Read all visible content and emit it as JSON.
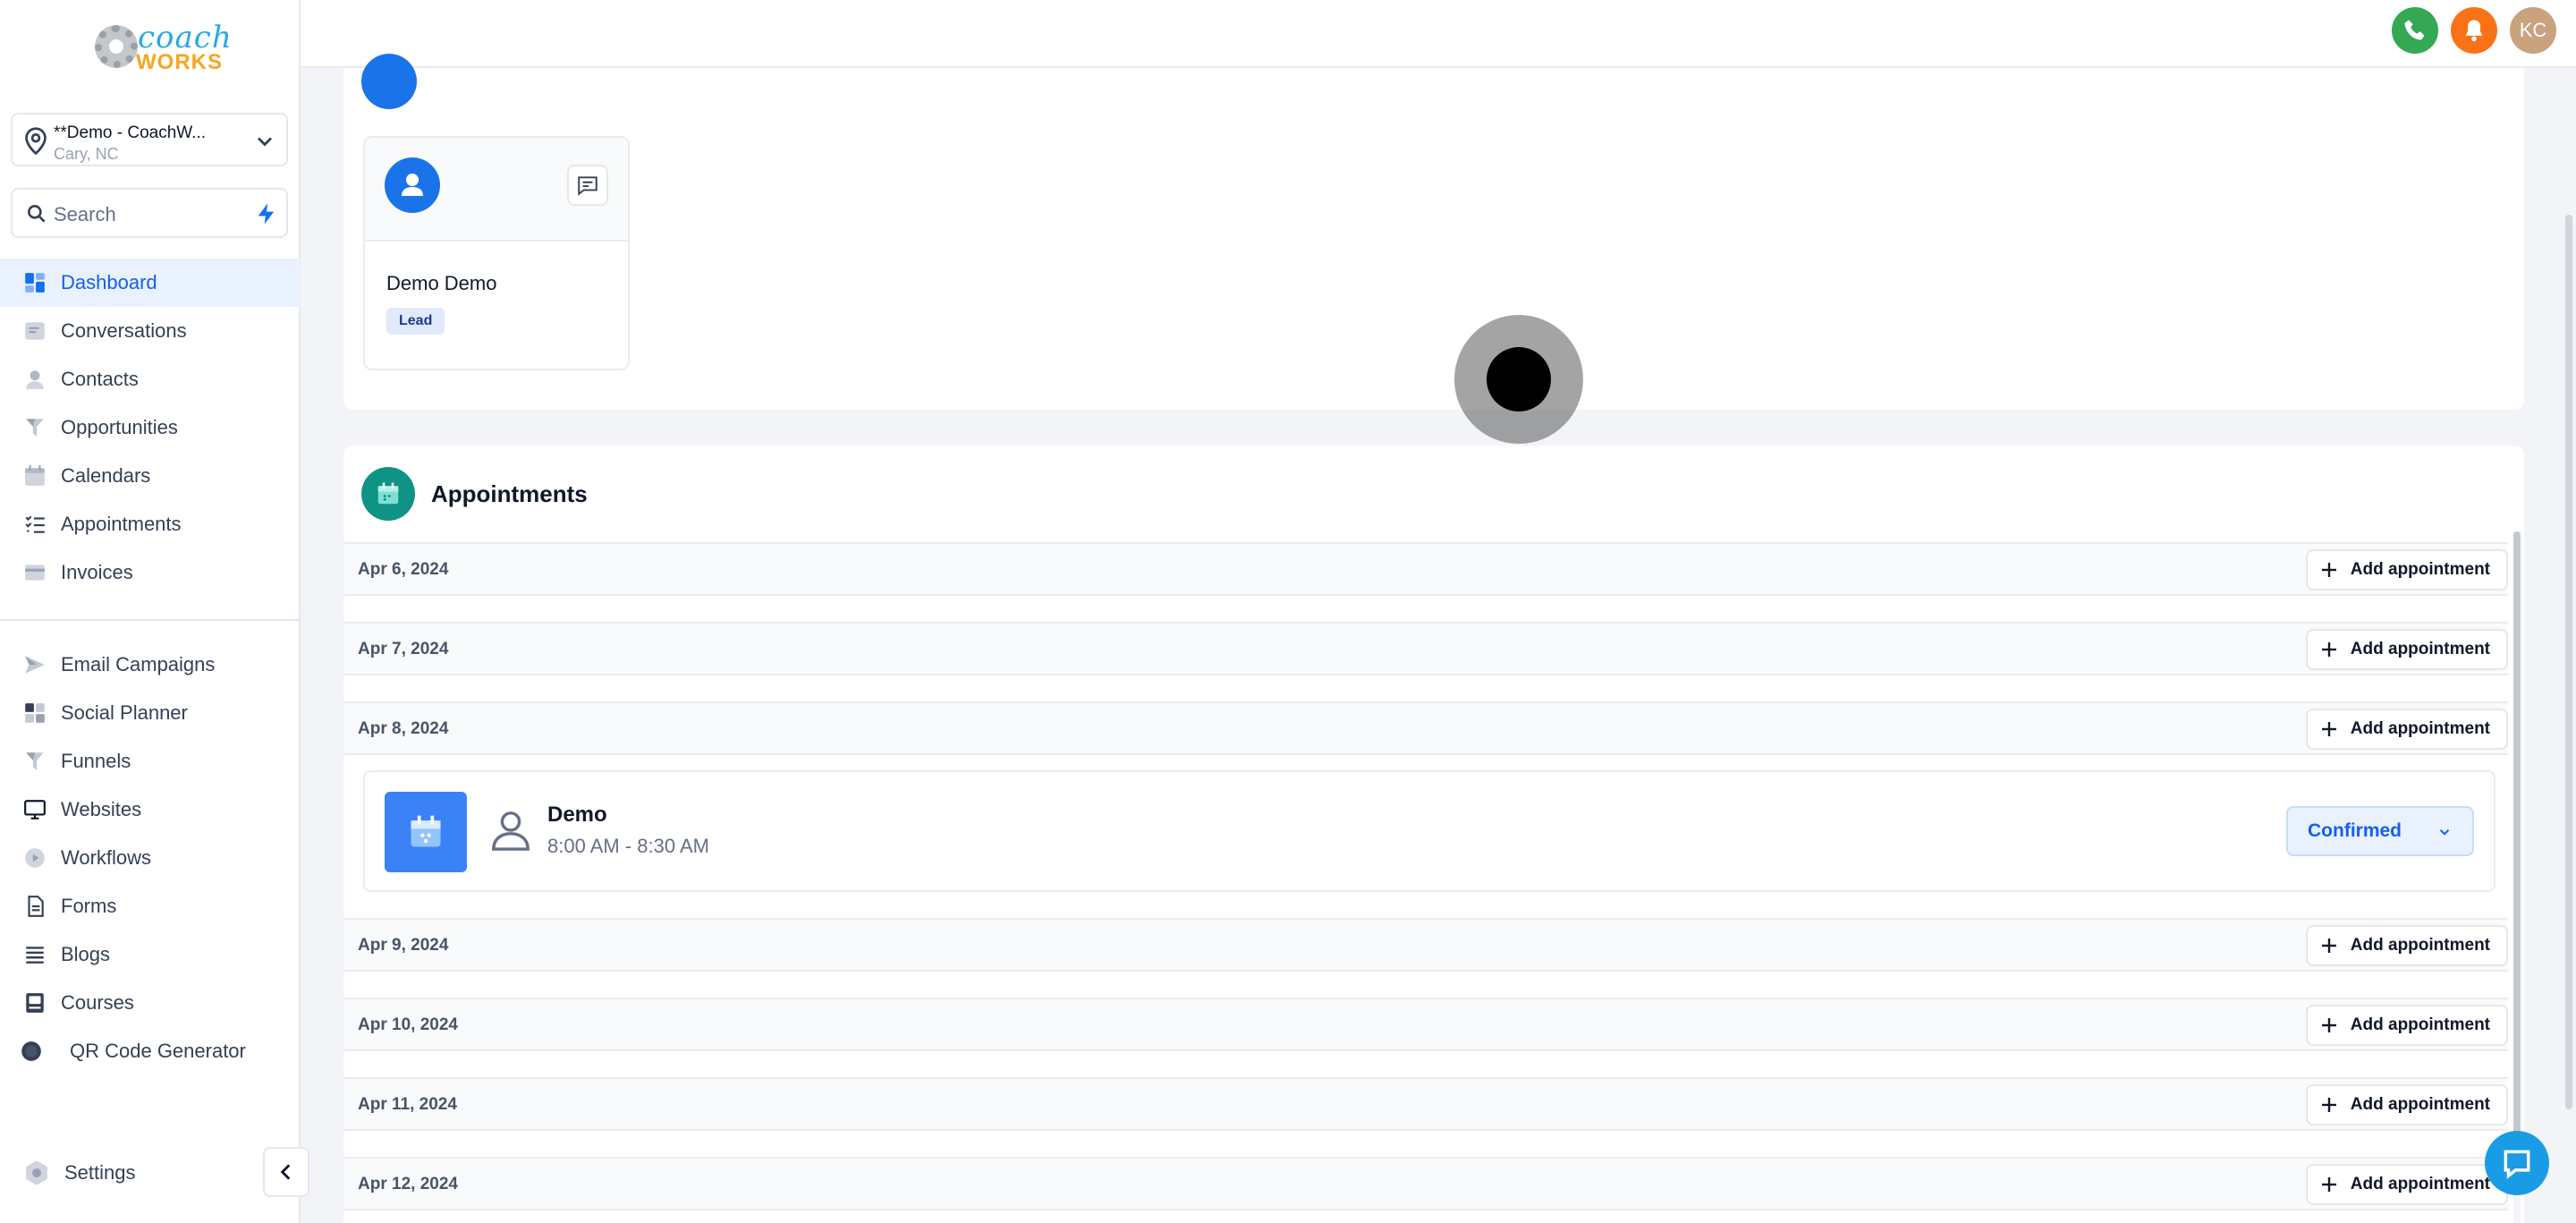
{
  "brand": {
    "logo_top": "coach",
    "logo_bottom": "WORKS"
  },
  "location": {
    "name": "**Demo - CoachW...",
    "city": "Cary, NC"
  },
  "search": {
    "placeholder": "Search"
  },
  "nav_primary": [
    {
      "label": "Dashboard",
      "icon": "dashboard-icon",
      "active": true
    },
    {
      "label": "Conversations",
      "icon": "conversations-icon"
    },
    {
      "label": "Contacts",
      "icon": "contacts-icon"
    },
    {
      "label": "Opportunities",
      "icon": "opportunities-icon"
    },
    {
      "label": "Calendars",
      "icon": "calendar-icon"
    },
    {
      "label": "Appointments",
      "icon": "appointments-icon"
    },
    {
      "label": "Invoices",
      "icon": "invoices-icon"
    }
  ],
  "nav_secondary": [
    {
      "label": "Email Campaigns",
      "icon": "send-icon"
    },
    {
      "label": "Social Planner",
      "icon": "grid-icon"
    },
    {
      "label": "Funnels",
      "icon": "funnel-icon"
    },
    {
      "label": "Websites",
      "icon": "monitor-icon"
    },
    {
      "label": "Workflows",
      "icon": "workflow-icon"
    },
    {
      "label": "Forms",
      "icon": "form-icon"
    },
    {
      "label": "Blogs",
      "icon": "blog-icon"
    },
    {
      "label": "Courses",
      "icon": "course-icon"
    },
    {
      "label": "QR Code Generator",
      "icon": "qr-icon"
    }
  ],
  "settings_label": "Settings",
  "topbar": {
    "user_initials": "KC",
    "phone_color": "#34a853",
    "bell_color": "#f97316",
    "avatar_color": "#c9a27e"
  },
  "contact": {
    "name": "Demo Demo",
    "tag": "Lead"
  },
  "appointments": {
    "title": "Appointments",
    "add_label": "Add appointment",
    "days": [
      {
        "date": "Apr 6, 2024",
        "events": []
      },
      {
        "date": "Apr 7, 2024",
        "events": []
      },
      {
        "date": "Apr 8, 2024",
        "events": [
          {
            "title": "Demo",
            "time": "8:00 AM - 8:30 AM",
            "status": "Confirmed"
          }
        ]
      },
      {
        "date": "Apr 9, 2024",
        "events": []
      },
      {
        "date": "Apr 10, 2024",
        "events": []
      },
      {
        "date": "Apr 11, 2024",
        "events": []
      },
      {
        "date": "Apr 12, 2024",
        "events": []
      }
    ]
  },
  "colors": {
    "accent": "#155eef",
    "active_bg": "#e8f1fd",
    "appt_icon": "#0e9384",
    "event_calendar": "#3b82f6"
  }
}
